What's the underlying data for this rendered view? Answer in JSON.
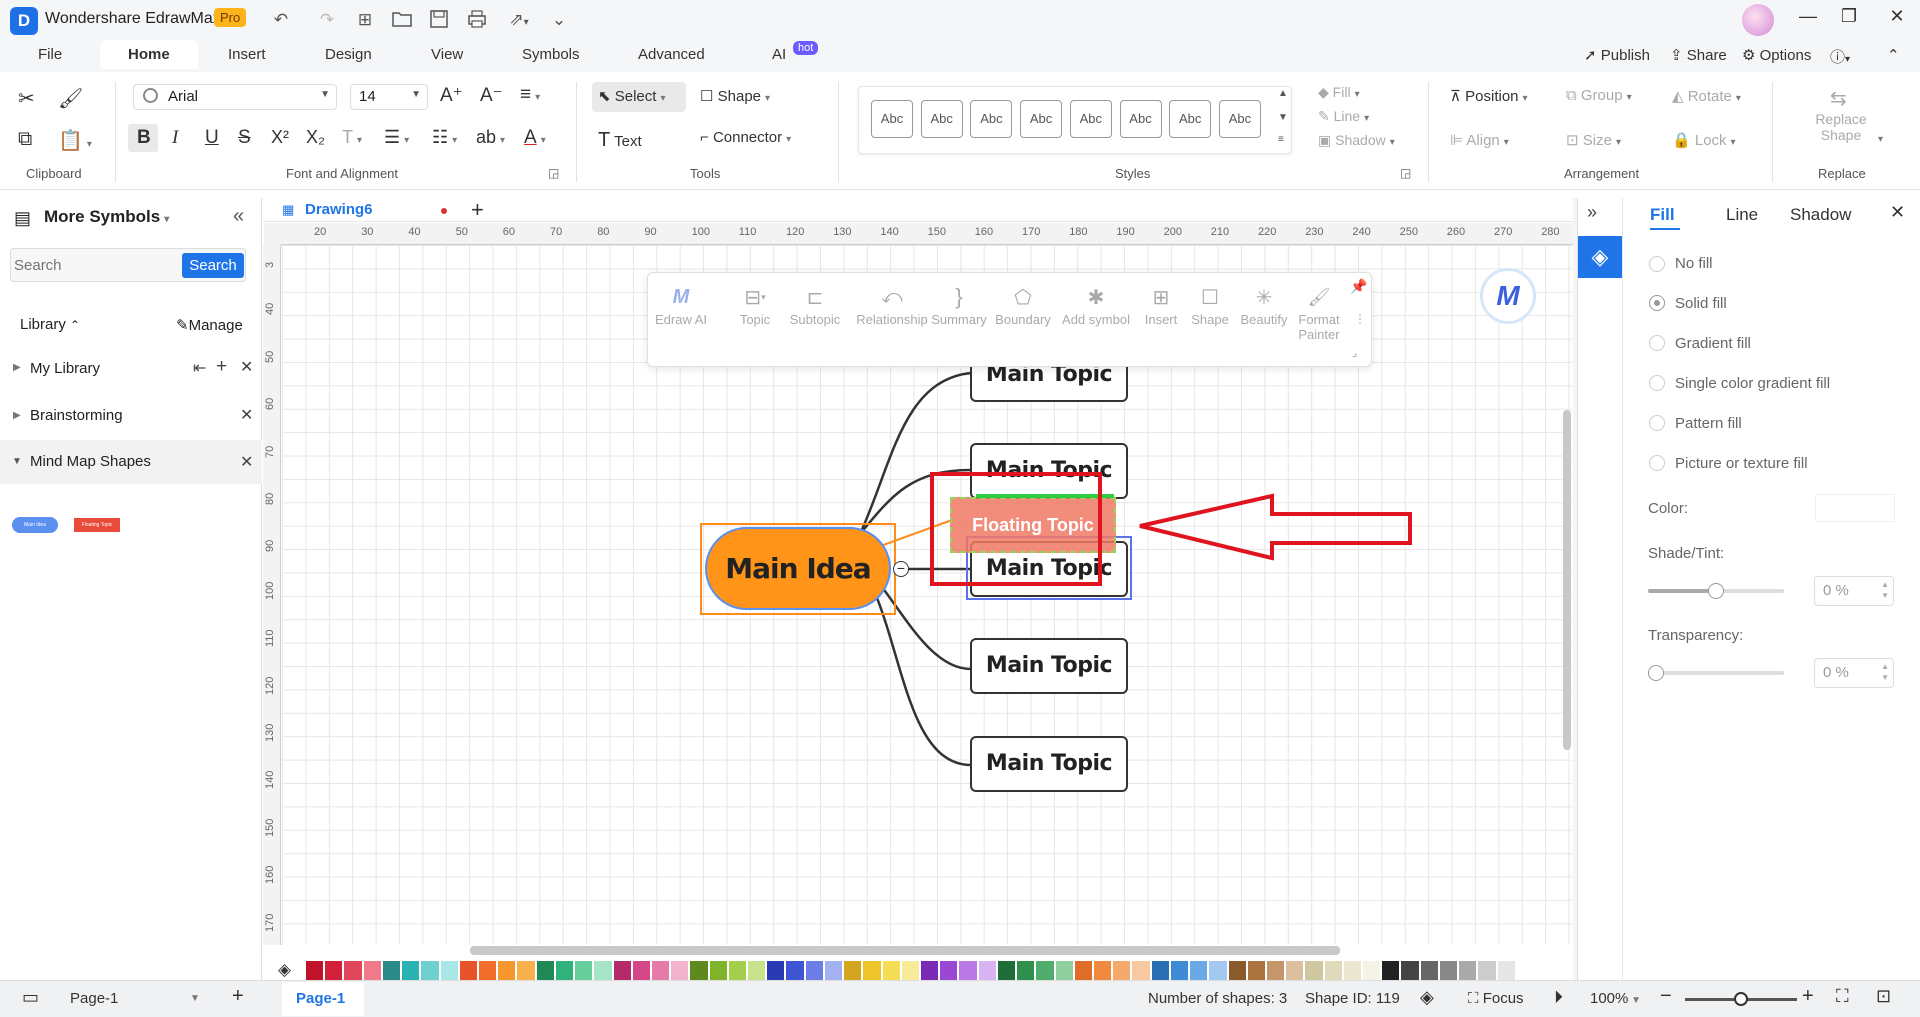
{
  "titlebar": {
    "logo": "D",
    "app_name": "Wondershare EdrawMax",
    "pro_badge": "Pro"
  },
  "menu": {
    "items": [
      "File",
      "Home",
      "Insert",
      "Design",
      "View",
      "Symbols",
      "Advanced",
      "AI"
    ],
    "ai_badge": "hot",
    "right": {
      "publish": "Publish",
      "share": "Share",
      "options": "Options"
    }
  },
  "ribbon": {
    "groups": {
      "clipboard": "Clipboard",
      "font": "Font and Alignment",
      "tools": "Tools",
      "styles": "Styles",
      "arrangement": "Arrangement",
      "replace": "Replace"
    },
    "font_family": "Arial",
    "font_size": "14",
    "tools": {
      "select": "Select",
      "shape": "Shape",
      "text": "Text",
      "connector": "Connector"
    },
    "style_sample": "Abc",
    "style_count": 8,
    "fill": "Fill",
    "line": "Line",
    "shadow": "Shadow",
    "position": "Position",
    "group": "Group",
    "rotate": "Rotate",
    "align": "Align",
    "size": "Size",
    "lock": "Lock",
    "replace_shape": "Replace Shape"
  },
  "left_panel": {
    "title": "More Symbols",
    "search_placeholder": "Search",
    "search_button": "Search",
    "library_label": "Library",
    "manage": "Manage",
    "libraries": [
      "My Library",
      "Brainstorming",
      "Mind Map Shapes"
    ],
    "thumb_main": "Main Idea",
    "thumb_float": "Floating Topic"
  },
  "document": {
    "tab_name": "Drawing6"
  },
  "ruler": {
    "h_labels": [
      "20",
      "30",
      "40",
      "50",
      "60",
      "70",
      "80",
      "90",
      "100",
      "110",
      "120",
      "130",
      "140",
      "150",
      "160",
      "170",
      "180",
      "190",
      "200",
      "210",
      "220",
      "230",
      "240",
      "250",
      "260",
      "270",
      "280"
    ],
    "v_labels": [
      "3",
      "40",
      "50",
      "60",
      "70",
      "80",
      "90",
      "100",
      "110",
      "120",
      "130",
      "140",
      "150",
      "160",
      "170"
    ]
  },
  "floating_toolbar": {
    "items": [
      "Edraw AI",
      "Topic",
      "Subtopic",
      "Relationship",
      "Summary",
      "Boundary",
      "Add symbol",
      "Insert",
      "Shape",
      "Beautify",
      "Format Painter"
    ]
  },
  "mindmap": {
    "main_idea": "Main Idea",
    "topics": [
      "Main Topic",
      "Main Topic",
      "Main Topic",
      "Main Topic",
      "Main Topic"
    ],
    "floating_topic": "Floating Topic"
  },
  "right_panel": {
    "tabs": [
      "Fill",
      "Line",
      "Shadow"
    ],
    "fill_options": [
      "No fill",
      "Solid fill",
      "Gradient fill",
      "Single color gradient fill",
      "Pattern fill",
      "Picture or texture fill"
    ],
    "selected_fill": "Solid fill",
    "color_label": "Color:",
    "shade_label": "Shade/Tint:",
    "shade_value": "0 %",
    "shade_level": 0.5,
    "transparency_label": "Transparency:",
    "transparency_value": "0 %",
    "transparency_level": 0
  },
  "status": {
    "page_select": "Page-1",
    "page_tab": "Page-1",
    "shape_count": "Number of shapes: 3",
    "shape_id": "Shape ID: 119",
    "focus": "Focus",
    "zoom": "100%",
    "zoom_level": 0.5
  },
  "colors": {
    "accent": "#1f75e8",
    "main_idea_fill": "#ff9419",
    "floating_fill": "#f08a73",
    "annotation_red": "#e0141e",
    "palette": [
      "#c0132a",
      "#d3203a",
      "#e2465b",
      "#f07a8a",
      "#2a8a8a",
      "#2bb3b3",
      "#6fd0d0",
      "#a9e6e6",
      "#e8542a",
      "#f06d2c",
      "#f5962f",
      "#f8b04c",
      "#1f8a55",
      "#2fb37a",
      "#67cf9e",
      "#a6e4c7",
      "#b42a6a",
      "#d4488a",
      "#e67aa9",
      "#f2b3cd",
      "#5d8a1f",
      "#7fb32a",
      "#a3cf4c",
      "#c9e38a",
      "#2a39b4",
      "#3f55d4",
      "#6a7ee6",
      "#a3b0f2",
      "#d4a61f",
      "#edc42a",
      "#f5dd55",
      "#f8ea99",
      "#7a2ab4",
      "#9a48d4",
      "#b97ae6",
      "#d8b3f2",
      "#1f6e3a",
      "#2f8f4d",
      "#4fae6b",
      "#8fcf9f",
      "#e06c2a",
      "#f08a3f",
      "#f5a96a",
      "#f8c9a0",
      "#2a6eb4",
      "#3f8ad4",
      "#6aa9e6",
      "#a3c9f2",
      "#8a5a2a",
      "#a97440",
      "#c4966a",
      "#dbbf9f",
      "#cfc7a0",
      "#e0d9ba",
      "#ece7d0",
      "#f5f2e6",
      "#222222",
      "#444444",
      "#666666",
      "#888888",
      "#aaaaaa",
      "#cccccc",
      "#e6e6e6",
      "#ffffff"
    ]
  }
}
